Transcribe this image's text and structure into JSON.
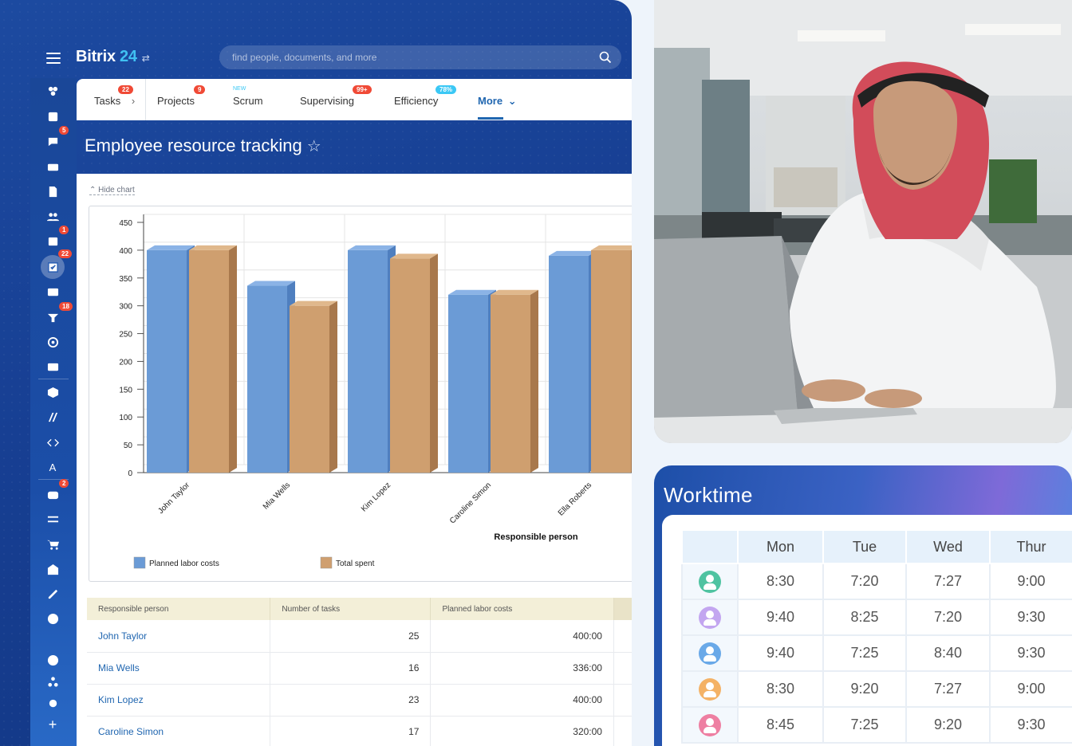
{
  "header": {
    "brand_name": "Bitrix",
    "brand_number": "24",
    "search_placeholder": "find people, documents, and more"
  },
  "rail": {
    "badges": {
      "chat": "5",
      "calendar": "1",
      "tasks": "22",
      "feed": "18",
      "market": "2"
    },
    "letter_item": "A"
  },
  "tabs": [
    {
      "label": "Tasks",
      "badge": "22"
    },
    {
      "label": "Projects",
      "badge": "9"
    },
    {
      "label": "Scrum",
      "tag": "NEW"
    },
    {
      "label": "Supervising",
      "badge": "99+"
    },
    {
      "label": "Efficiency",
      "badge": "78%"
    },
    {
      "label": "More"
    }
  ],
  "page": {
    "title": "Employee resource tracking",
    "hide_chart": "Hide chart"
  },
  "chart_data": {
    "type": "bar",
    "categories": [
      "John Taylor",
      "Mia Wells",
      "Kim Lopez",
      "Caroline Simon",
      "Ella Roberts"
    ],
    "series": [
      {
        "name": "Planned labor costs",
        "values": [
          400,
          336,
          400,
          320,
          390
        ],
        "color": "#6b9bd6"
      },
      {
        "name": "Total spent",
        "values": [
          400,
          300,
          385,
          320,
          400
        ],
        "color": "#cf9f6f"
      }
    ],
    "xlabel": "Responsible person",
    "ylabel": "",
    "ylim": [
      0,
      450
    ],
    "yticks": [
      0,
      50,
      100,
      150,
      200,
      250,
      300,
      350,
      400,
      450
    ],
    "grid": true,
    "legend_position": "bottom-left"
  },
  "table": {
    "headers": [
      "Responsible person",
      "Number of tasks",
      "Planned labor costs"
    ],
    "rows": [
      {
        "name": "John Taylor",
        "tasks": "25",
        "cost": "400:00"
      },
      {
        "name": "Mia Wells",
        "tasks": "16",
        "cost": "336:00"
      },
      {
        "name": "Kim Lopez",
        "tasks": "23",
        "cost": "400:00"
      },
      {
        "name": "Caroline Simon",
        "tasks": "17",
        "cost": "320:00"
      }
    ]
  },
  "worktime": {
    "title": "Worktime",
    "days": [
      "Mon",
      "Tue",
      "Wed",
      "Thur"
    ],
    "rows": [
      {
        "avatar_color": "#4fc3a1",
        "times": [
          "8:30",
          "7:20",
          "7:27",
          "9:00"
        ]
      },
      {
        "avatar_color": "#c3a6f0",
        "times": [
          "9:40",
          "8:25",
          "7:20",
          "9:30"
        ]
      },
      {
        "avatar_color": "#6aa9e8",
        "times": [
          "9:40",
          "7:25",
          "8:40",
          "9:30"
        ]
      },
      {
        "avatar_color": "#f4b266",
        "times": [
          "8:30",
          "9:20",
          "7:27",
          "9:00"
        ]
      },
      {
        "avatar_color": "#ee7fa2",
        "times": [
          "8:45",
          "7:25",
          "9:20",
          "9:30"
        ]
      }
    ]
  },
  "colors": {
    "accent": "#2066b0",
    "badge": "#f04a36",
    "brand_number": "#40c1f2"
  }
}
